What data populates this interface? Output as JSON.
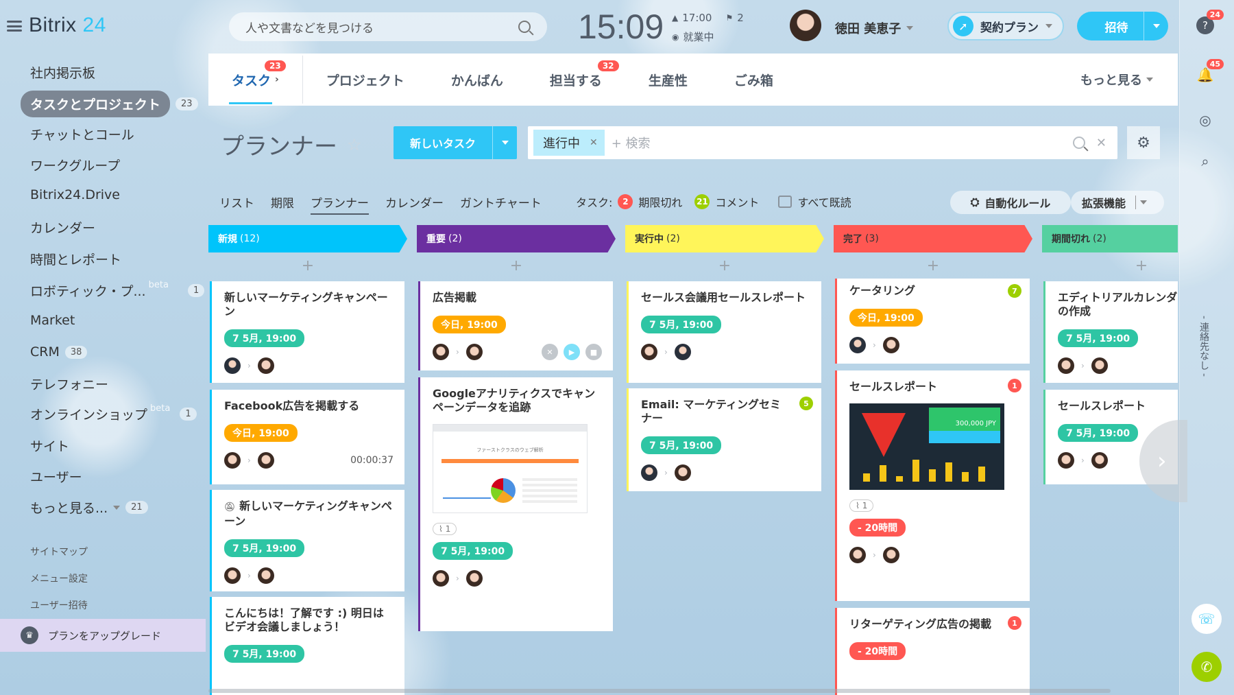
{
  "app": {
    "logo_a": "Bitrix",
    "logo_b": "24"
  },
  "header": {
    "search_placeholder": "人や文書などを見つける",
    "clock": "15:09",
    "alarm_time": "17:00",
    "flag_count": "2",
    "work_status": "就業中",
    "user_name": "徳田 美恵子",
    "plan_label": "契約プラン",
    "invite_label": "招待"
  },
  "sidebar": {
    "items": [
      {
        "label": "社内掲示板"
      },
      {
        "label": "タスクとプロジェクト",
        "count": "23"
      },
      {
        "label": "チャットとコール"
      },
      {
        "label": "ワークグループ"
      },
      {
        "label": "Bitrix24.Drive"
      },
      {
        "label": "カレンダー"
      },
      {
        "label": "時間とレポート"
      },
      {
        "label": "ロボティック・プ...",
        "beta": "beta",
        "count": "1"
      },
      {
        "label": "Market"
      },
      {
        "label": "CRM",
        "count": "38"
      },
      {
        "label": "テレフォニー"
      },
      {
        "label": "オンラインショップ",
        "beta": "beta",
        "count": "1"
      },
      {
        "label": "サイト"
      },
      {
        "label": "ユーザー"
      },
      {
        "label": "もっと見る...",
        "count": "21"
      }
    ],
    "sitemap": "サイトマップ",
    "menu_settings": "メニュー設定",
    "invite_users": "ユーザー招待",
    "upgrade": "プランをアップグレード"
  },
  "rail": {
    "help_badge": "24",
    "bell_badge": "45",
    "vertical_text": "- 連絡先なし -"
  },
  "tabs": [
    {
      "label": "タスク",
      "badge": "23"
    },
    {
      "label": "プロジェクト"
    },
    {
      "label": "かんばん"
    },
    {
      "label": "担当する",
      "badge": "32"
    },
    {
      "label": "生産性"
    },
    {
      "label": "ごみ箱"
    }
  ],
  "tabs_more": "もっと見る",
  "page_title": "プランナー",
  "new_task": "新しいタスク",
  "filter": {
    "chip": "進行中",
    "placeholder": "+ 検索"
  },
  "views": [
    "リスト",
    "期限",
    "プランナー",
    "カレンダー",
    "ガントチャート"
  ],
  "counters": {
    "tasks_label": "タスク:",
    "overdue_count": "2",
    "overdue_label": "期限切れ",
    "comment_count": "21",
    "comment_label": "コメント",
    "read_all": "すべて既読"
  },
  "automation": "自動化ルール",
  "extensions": "拡張機能",
  "columns": [
    {
      "title": "新規",
      "count": "(12)",
      "color": "#00c4fb",
      "text": "light",
      "cards": [
        {
          "title": "新しいマーケティングキャンペーン",
          "deadline": "7 5月, 19:00",
          "dl": "green"
        },
        {
          "title": "Facebook広告を掲載する",
          "deadline": "今日, 19:00",
          "dl": "orange",
          "timer": "00:00:37"
        },
        {
          "title": "新しいマーケティングキャンペーン",
          "deadline": "7 5月, 19:00",
          "dl": "green"
        },
        {
          "title": "こんにちは！了解です :) 明日はビデオ会議しましょう！",
          "deadline": "7 5月, 19:00",
          "dl": "green"
        }
      ]
    },
    {
      "title": "重要",
      "count": "(2)",
      "color": "#6b2fa0",
      "text": "light",
      "cards": [
        {
          "title": "広告掲載",
          "deadline": "今日, 19:00",
          "dl": "orange"
        },
        {
          "title": "Googleアナリティクスでキャンペーンデータを追跡",
          "attach": "1",
          "deadline": "7 5月, 19:00",
          "dl": "green",
          "preview_title": "ファーストクラスのウェブ解析"
        }
      ]
    },
    {
      "title": "実行中",
      "count": "(2)",
      "color": "#fff55a",
      "text": "dark",
      "cards": [
        {
          "title": "セールス会議用セールスレポート",
          "deadline": "7 5月, 19:00",
          "dl": "green"
        },
        {
          "title": "Email: マーケティングセミナー",
          "count": "5",
          "deadline": "7 5月, 19:00",
          "dl": "green"
        }
      ]
    },
    {
      "title": "完了",
      "count": "(3)",
      "color": "#ff5752",
      "text": "dark",
      "cards": [
        {
          "title": "ケータリング",
          "count": "7",
          "deadline": "今日, 19:00",
          "dl": "orange"
        },
        {
          "title": "セールスレポート",
          "count": "1",
          "attach": "1",
          "deadline": "- 20時間",
          "dl": "red",
          "dash_value": "300,000 JPY"
        },
        {
          "title": "リターゲティング広告の掲載",
          "count": "1",
          "deadline": "- 20時間",
          "dl": "red"
        }
      ]
    },
    {
      "title": "期間切れ",
      "count": "(2)",
      "color": "#55d0a0",
      "text": "dark",
      "cards": [
        {
          "title": "エディトリアルカレンダーの作成",
          "deadline": "7 5月, 19:00",
          "dl": "green"
        },
        {
          "title": "セールスレポート",
          "deadline": "7 5月, 19:00",
          "dl": "green"
        }
      ]
    }
  ]
}
